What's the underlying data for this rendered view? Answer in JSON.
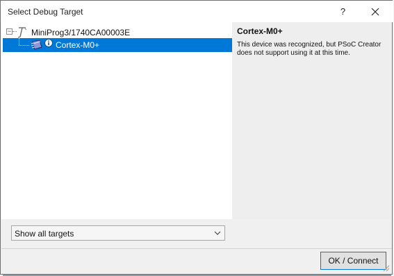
{
  "window": {
    "title": "Select Debug Target",
    "help_label": "?",
    "close_icon": "close-icon"
  },
  "tree": {
    "root": {
      "label": "MiniProg3/1740CA00003E",
      "expanded": true,
      "icon": "probe-icon"
    },
    "child": {
      "label": "Cortex-M0+",
      "selected": true,
      "icon": "chip-icon",
      "status_icon": "info-icon"
    }
  },
  "details": {
    "title": "Cortex-M0+",
    "message": "This device was recognized, but PSoC Creator\ndoes not support using it at this time."
  },
  "filter": {
    "selected": "Show all targets"
  },
  "actions": {
    "connect_label": "OK / Connect"
  },
  "colors": {
    "selection": "#0078d7",
    "window_background": "#f0f0f0",
    "pane_background": "#ffffff",
    "details_background": "#eeeeee"
  }
}
